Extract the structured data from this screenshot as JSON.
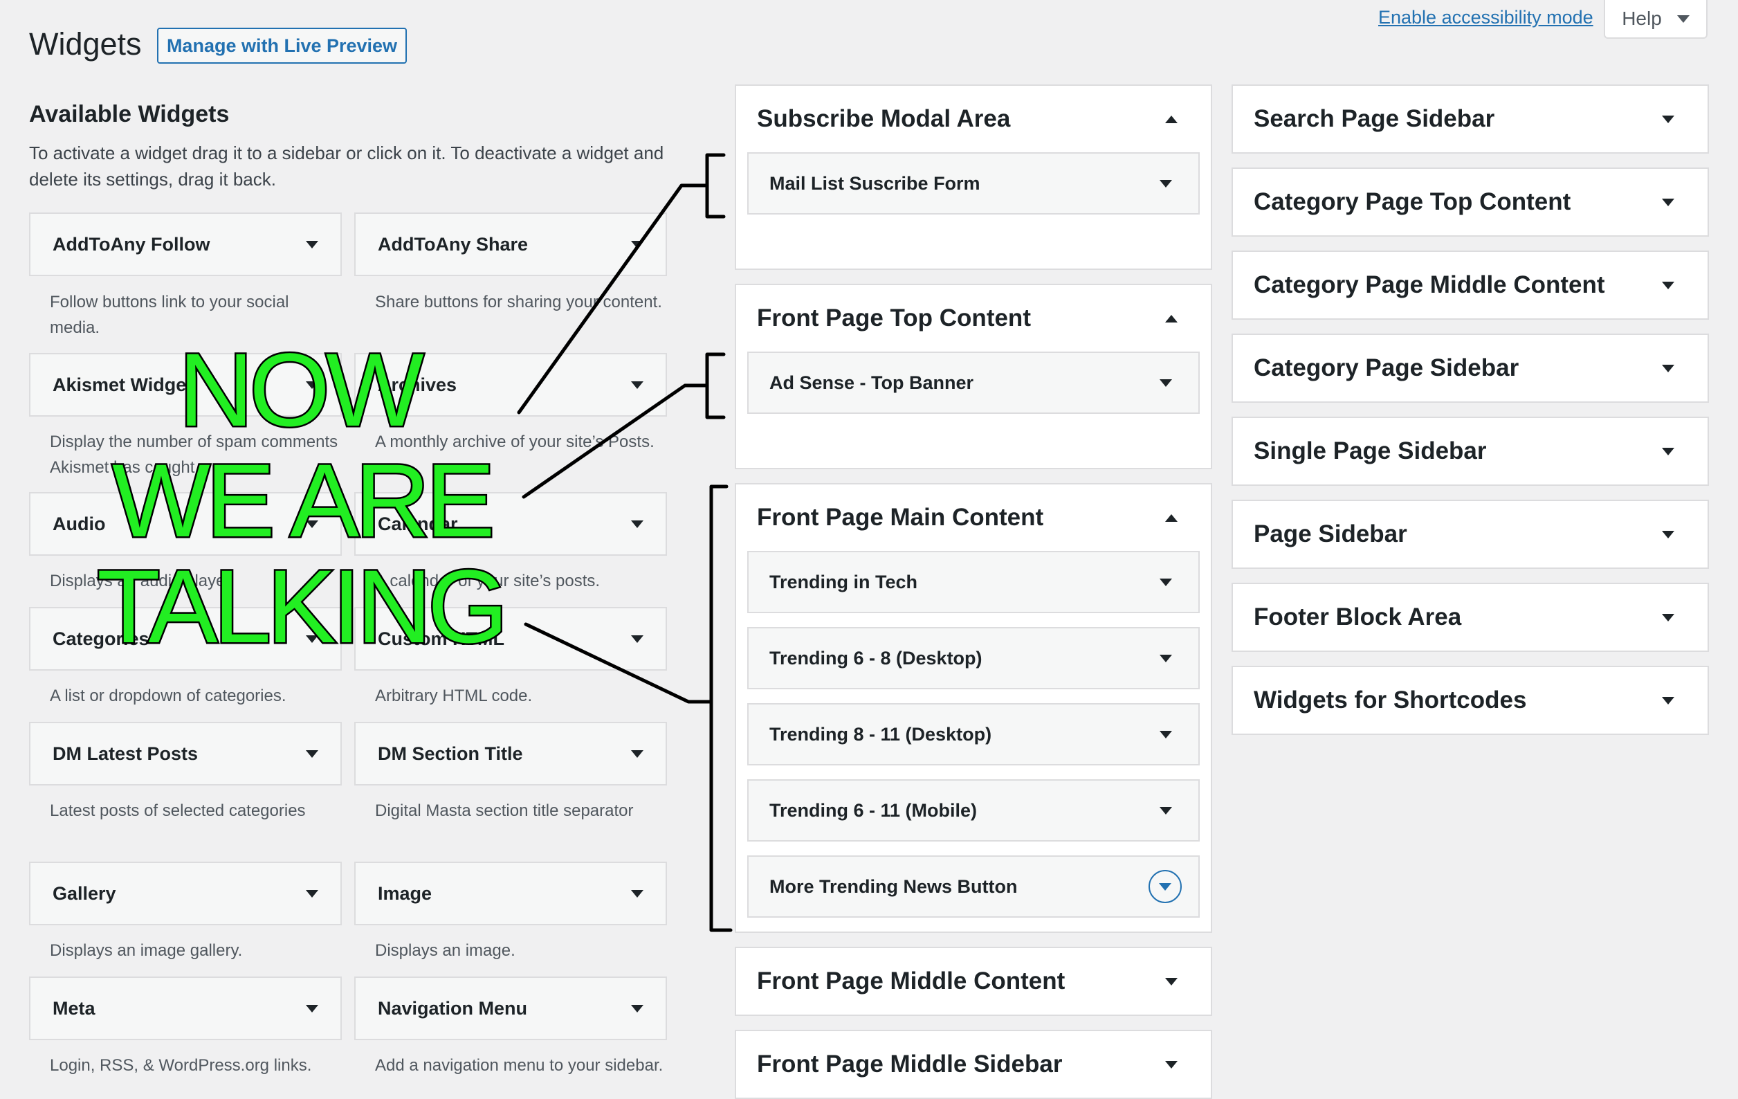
{
  "header": {
    "title": "Widgets",
    "live_preview_label": "Manage with Live Preview",
    "accessibility_link": "Enable accessibility mode",
    "help_label": "Help"
  },
  "available": {
    "title": "Available Widgets",
    "description": "To activate a widget drag it to a sidebar or click on it. To deactivate a widget and delete its settings, drag it back.",
    "widgets": [
      {
        "name": "AddToAny Follow",
        "desc": "Follow buttons link to your social media."
      },
      {
        "name": "AddToAny Share",
        "desc": "Share buttons for sharing your content."
      },
      {
        "name": "Akismet Widget",
        "desc": "Display the number of spam comments Akismet has caught"
      },
      {
        "name": "Archives",
        "desc": "A monthly archive of your site’s Posts."
      },
      {
        "name": "Audio",
        "desc": "Displays an audio player."
      },
      {
        "name": "Calendar",
        "desc": "A calendar of your site’s posts."
      },
      {
        "name": "Categories",
        "desc": "A list or dropdown of categories."
      },
      {
        "name": "Custom HTML",
        "desc": "Arbitrary HTML code."
      },
      {
        "name": "DM Latest Posts",
        "desc": "Latest posts of selected categories"
      },
      {
        "name": "DM Section Title",
        "desc": "Digital Masta section title separator"
      },
      {
        "name": "Gallery",
        "desc": "Displays an image gallery."
      },
      {
        "name": "Image",
        "desc": "Displays an image."
      },
      {
        "name": "Meta",
        "desc": "Login, RSS, & WordPress.org links."
      },
      {
        "name": "Navigation Menu",
        "desc": "Add a navigation menu to your sidebar."
      }
    ]
  },
  "areas": [
    {
      "name": "Subscribe Modal Area",
      "widgets": [
        "Mail List Suscribe Form"
      ]
    },
    {
      "name": "Front Page Top Content",
      "widgets": [
        "Ad Sense - Top Banner"
      ]
    },
    {
      "name": "Front Page Main Content",
      "widgets": [
        "Trending in Tech",
        "Trending 6 - 8 (Desktop)",
        "Trending 8 - 11 (Desktop)",
        "Trending 6 - 11 (Mobile)",
        "More Trending News Button"
      ]
    },
    {
      "name": "Front Page Middle Content",
      "widgets": []
    },
    {
      "name": "Front Page Middle Sidebar",
      "widgets": []
    }
  ],
  "sidebars": [
    {
      "name": "Search Page Sidebar"
    },
    {
      "name": "Category Page Top Content"
    },
    {
      "name": "Category Page Middle Content"
    },
    {
      "name": "Category Page Sidebar"
    },
    {
      "name": "Single Page Sidebar"
    },
    {
      "name": "Page Sidebar"
    },
    {
      "name": "Footer Block Area"
    },
    {
      "name": "Widgets for Shortcodes"
    }
  ],
  "overlay": {
    "lines": [
      "NOW",
      "WE ARE",
      "TALKING"
    ],
    "text_color": "#22ee22"
  },
  "colors": {
    "accent": "#2271b1",
    "background": "#f0f0f1"
  }
}
